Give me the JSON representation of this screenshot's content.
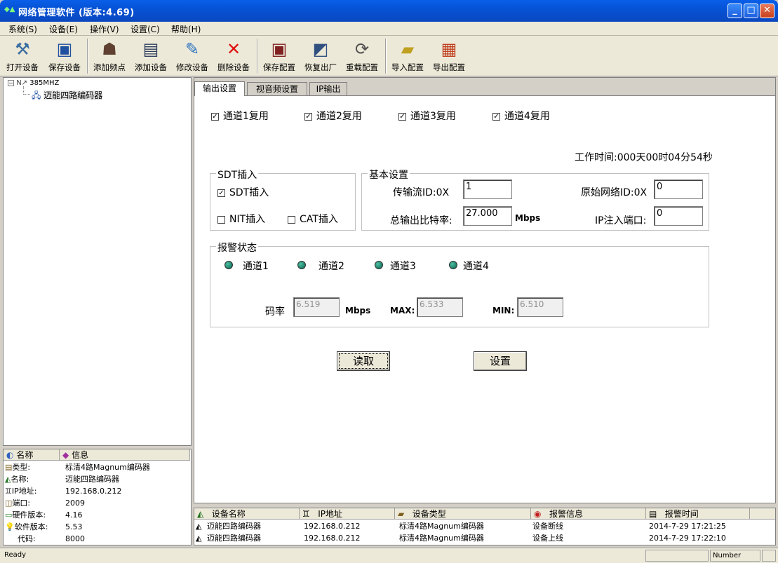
{
  "window": {
    "title": "网络管理软件 (版本:4.69)"
  },
  "menu": [
    "系统(S)",
    "设备(E)",
    "操作(V)",
    "设置(C)",
    "帮助(H)"
  ],
  "toolbar": [
    {
      "label": "打开设备",
      "icon": "open-device-icon"
    },
    {
      "label": "保存设备",
      "icon": "save-device-icon"
    },
    {
      "label": "添加频点",
      "icon": "add-frequency-icon"
    },
    {
      "label": "添加设备",
      "icon": "add-device-icon"
    },
    {
      "label": "修改设备",
      "icon": "edit-device-icon"
    },
    {
      "label": "删除设备",
      "icon": "delete-device-icon"
    },
    {
      "label": "保存配置",
      "icon": "save-config-icon"
    },
    {
      "label": "恢复出厂",
      "icon": "factory-reset-icon"
    },
    {
      "label": "重载配置",
      "icon": "reload-config-icon"
    },
    {
      "label": "导入配置",
      "icon": "import-config-icon"
    },
    {
      "label": "导出配置",
      "icon": "export-config-icon"
    }
  ],
  "tree": {
    "root": "385MHZ",
    "child": "迈能四路编码器"
  },
  "info": {
    "headers": [
      "名称",
      "信息"
    ],
    "rows": [
      {
        "key": "类型:",
        "value": "标清4路Magnum编码器"
      },
      {
        "key": "名称:",
        "value": "迈能四路编码器"
      },
      {
        "key": "IP地址:",
        "value": "192.168.0.212"
      },
      {
        "key": "端口:",
        "value": "2009"
      },
      {
        "key": "硬件版本:",
        "value": "4.16"
      },
      {
        "key": "软件版本:",
        "value": "5.53"
      },
      {
        "key": "代码:",
        "value": "8000"
      }
    ]
  },
  "tabs": [
    "输出设置",
    "视音频设置",
    "IP输出"
  ],
  "channels_mux": [
    "通道1复用",
    "通道2复用",
    "通道3复用",
    "通道4复用"
  ],
  "work_time": "工作时间:000天00时04分54秒",
  "sdt_group": {
    "title": "SDT插入",
    "sdt": "SDT插入",
    "nit": "NIT插入",
    "cat": "CAT插入"
  },
  "basic_group": {
    "title": "基本设置",
    "ts_id_label": "传输流ID:0X",
    "ts_id_value": "1",
    "onid_label": "原始网络ID:0X",
    "onid_value": "0",
    "bitrate_label": "总输出比特率:",
    "bitrate_value": "27.000",
    "bitrate_unit": "Mbps",
    "ip_port_label": "IP注入端口:",
    "ip_port_value": "0"
  },
  "alarm_group": {
    "title": "报警状态",
    "channels": [
      "通道1",
      "通道2",
      "通道3",
      "通道4"
    ],
    "rate_label": "码率",
    "rate_value": "6.519",
    "rate_unit": "Mbps",
    "max_label": "MAX:",
    "max_value": "6.533",
    "min_label": "MIN:",
    "min_value": "6.510"
  },
  "buttons": {
    "read": "读取",
    "set": "设置"
  },
  "log": {
    "headers": [
      "设备名称",
      "IP地址",
      "设备类型",
      "报警信息",
      "报警时间"
    ],
    "rows": [
      [
        "迈能四路编码器",
        "192.168.0.212",
        "标清4路Magnum编码器",
        "设备断线",
        "2014-7-29 17:21:25"
      ],
      [
        "迈能四路编码器",
        "192.168.0.212",
        "标清4路Magnum编码器",
        "设备上线",
        "2014-7-29 17:22:10"
      ]
    ]
  },
  "status": {
    "text": "Ready",
    "number": "Number"
  }
}
